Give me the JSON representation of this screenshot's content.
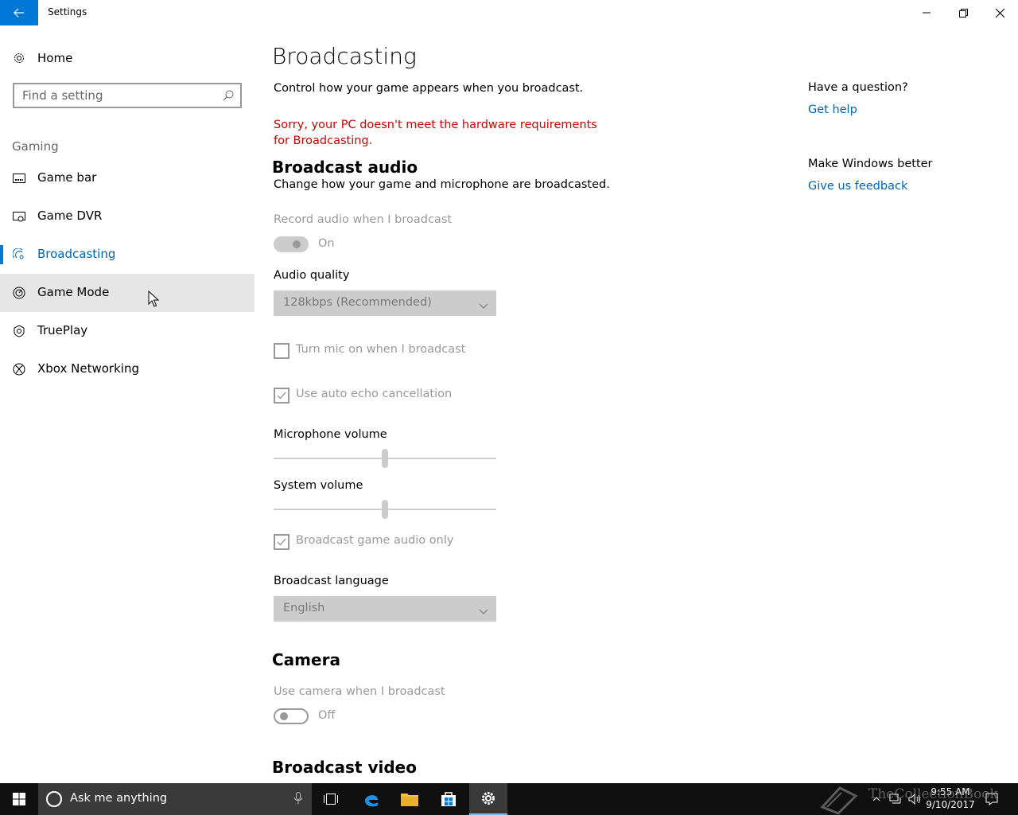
{
  "window": {
    "title": "Settings"
  },
  "sidebar": {
    "home_label": "Home",
    "search_placeholder": "Find a setting",
    "section_label": "Gaming",
    "items": [
      {
        "label": "Game bar",
        "icon": "game-bar-icon"
      },
      {
        "label": "Game DVR",
        "icon": "game-dvr-icon"
      },
      {
        "label": "Broadcasting",
        "icon": "broadcasting-icon",
        "active": true
      },
      {
        "label": "Game Mode",
        "icon": "game-mode-icon"
      },
      {
        "label": "TruePlay",
        "icon": "trueplay-icon"
      },
      {
        "label": "Xbox Networking",
        "icon": "xbox-icon"
      }
    ]
  },
  "main": {
    "title": "Broadcasting",
    "description": "Control how your game appears when you broadcast.",
    "error": "Sorry, your PC doesn't meet the hardware requirements for Broadcasting.",
    "audio": {
      "title": "Broadcast audio",
      "description": "Change how your game and microphone are broadcasted.",
      "record_label": "Record audio when I broadcast",
      "record_state": "On",
      "quality_label": "Audio quality",
      "quality_value": "128kbps (Recommended)",
      "mic_on_label": "Turn mic on when I broadcast",
      "mic_on_checked": false,
      "echo_label": "Use auto echo cancellation",
      "echo_checked": true,
      "mic_volume_label": "Microphone volume",
      "mic_volume": 0.5,
      "system_volume_label": "System volume",
      "system_volume": 0.5,
      "game_audio_only_label": "Broadcast game audio only",
      "game_audio_only_checked": true,
      "language_label": "Broadcast language",
      "language_value": "English"
    },
    "camera": {
      "title": "Camera",
      "use_camera_label": "Use camera when I broadcast",
      "use_camera_state": "Off"
    },
    "video": {
      "title": "Broadcast video"
    }
  },
  "right_pane": {
    "question": "Have a question?",
    "help_link": "Get help",
    "better": "Make Windows better",
    "feedback_link": "Give us feedback"
  },
  "taskbar": {
    "search_placeholder": "Ask me anything",
    "time": "9:55 AM",
    "date": "9/10/2017",
    "watermark": "TheCollectionBook"
  },
  "colors": {
    "accent": "#0078d7",
    "link": "#0063b1",
    "error": "#c50500",
    "disabled": "#999999",
    "taskbar": "#101010"
  }
}
